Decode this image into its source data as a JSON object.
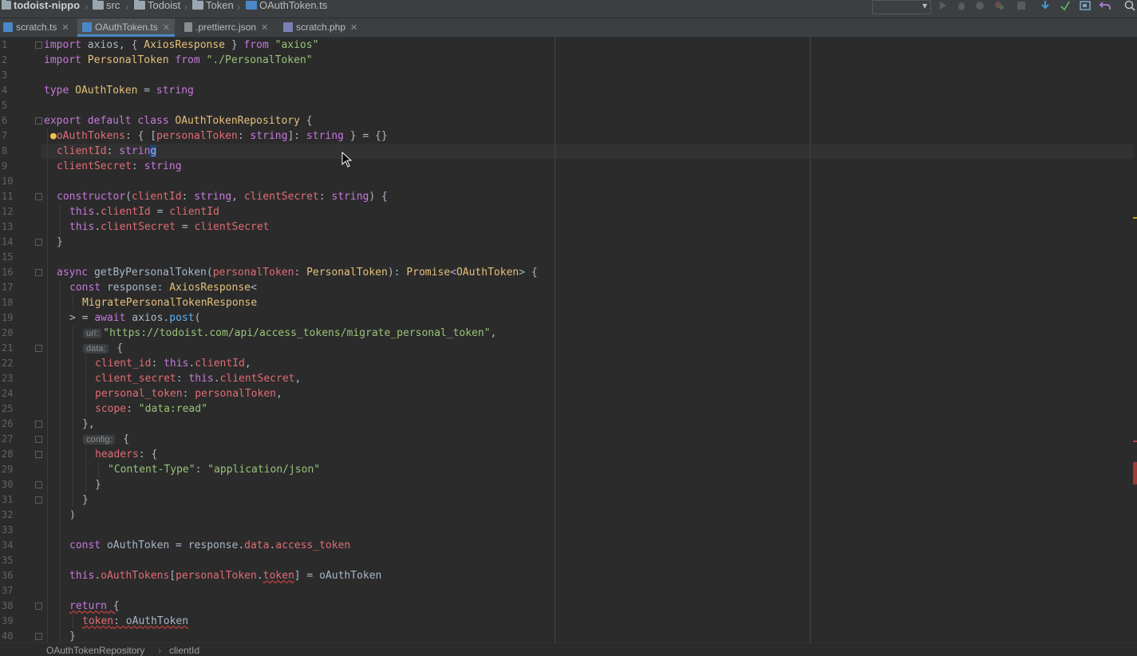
{
  "navbar": {
    "project": "todoist-nippo",
    "crumbs": [
      "src",
      "Todoist",
      "Token",
      "OAuthToken.ts"
    ]
  },
  "tabs": [
    {
      "label": "scratch.ts",
      "active": false
    },
    {
      "label": "OAuthToken.ts",
      "active": true
    },
    {
      "label": ".prettierrc.json",
      "active": false
    },
    {
      "label": "scratch.php",
      "active": false
    }
  ],
  "editor": {
    "line_numbers": [
      "1",
      "2",
      "3",
      "4",
      "5",
      "6",
      "7",
      "8",
      "9",
      "10",
      "11",
      "12",
      "13",
      "14",
      "15",
      "16",
      "17",
      "18",
      "19",
      "20",
      "21",
      "22",
      "23",
      "24",
      "25",
      "26",
      "27",
      "28",
      "29",
      "30",
      "31",
      "32",
      "33",
      "34",
      "35",
      "36",
      "37",
      "38",
      "39",
      "40"
    ],
    "code": {
      "l1": [
        "import",
        " axios, { ",
        "AxiosResponse",
        " } ",
        "from",
        " ",
        "\"axios\""
      ],
      "l2": [
        "import",
        " ",
        "PersonalToken",
        " ",
        "from",
        " ",
        "\"./PersonalToken\""
      ],
      "l4": [
        "type",
        " ",
        "OAuthToken",
        " = ",
        "string"
      ],
      "l6": [
        "export",
        " ",
        "default",
        " ",
        "class",
        " ",
        "OAuthTokenRepository",
        " {"
      ],
      "l7": [
        "oAuthTokens",
        ": { [",
        "personalToken",
        ": ",
        "string",
        "]: ",
        "string",
        " } = {}"
      ],
      "l8": [
        "clientId",
        ": ",
        "strin",
        "g"
      ],
      "l9": [
        "clientSecret",
        ": ",
        "string"
      ],
      "l11": [
        "constructor",
        "(",
        "clientId",
        ": ",
        "string",
        ", ",
        "clientSecret",
        ": ",
        "string",
        ") {"
      ],
      "l12": [
        "this",
        ".",
        "clientId",
        " = ",
        "clientId"
      ],
      "l13": [
        "this",
        ".",
        "clientSecret",
        " = ",
        "clientSecret"
      ],
      "l14": [
        "}"
      ],
      "l16": [
        "async",
        " ",
        "getByPersonalToken",
        "(",
        "personalToken",
        ": ",
        "PersonalToken",
        "): ",
        "Promise",
        "<",
        "OAuthToken",
        "> {"
      ],
      "l17": [
        "const",
        " response: ",
        "AxiosResponse",
        "<"
      ],
      "l18": [
        "MigratePersonalTokenResponse"
      ],
      "l19": [
        "> = ",
        "await",
        " axios.",
        "post",
        "("
      ],
      "l20": [
        "url:",
        "\"https://todoist.com/api/access_tokens/migrate_personal_token\"",
        ","
      ],
      "l21": [
        "data:",
        " {"
      ],
      "l22": [
        "client_id",
        ": ",
        "this",
        ".",
        "clientId",
        ","
      ],
      "l23": [
        "client_secret",
        ": ",
        "this",
        ".",
        "clientSecret",
        ","
      ],
      "l24": [
        "personal_token",
        ": ",
        "personalToken",
        ","
      ],
      "l25": [
        "scope",
        ": ",
        "\"data:read\""
      ],
      "l26": [
        "},"
      ],
      "l27": [
        "config:",
        " {"
      ],
      "l28": [
        "headers",
        ": {"
      ],
      "l29": [
        "\"Content-Type\"",
        ": ",
        "\"application/json\""
      ],
      "l30": [
        "}"
      ],
      "l31": [
        "}"
      ],
      "l32": [
        ")"
      ],
      "l34": [
        "const",
        " oAuthToken = response.",
        "data",
        ".",
        "access_token"
      ],
      "l36": [
        "this",
        ".",
        "oAuthTokens",
        "[",
        "personalToken",
        ".",
        "token",
        "] = oAuthToken"
      ],
      "l38": [
        "return",
        " {"
      ],
      "l39": [
        "token",
        ": oAuthToken"
      ],
      "l40": [
        "}"
      ]
    }
  },
  "bottom_breadcrumb": [
    "OAuthTokenRepository",
    "clientId"
  ],
  "colors": {
    "background": "#2b2b2b",
    "keyword": "#c678dd",
    "type": "#e5c07b",
    "string": "#98c379",
    "property": "#e06c75",
    "function": "#61afef",
    "tab_accent": "#4a88c7"
  },
  "icons": [
    "folder-icon",
    "typescript-file-icon",
    "json-file-icon",
    "php-file-icon",
    "close-icon",
    "run-icon",
    "debug-icon",
    "stop-icon",
    "vcs-update-icon",
    "vcs-commit-icon",
    "undo-icon",
    "search-icon",
    "bulb-icon"
  ]
}
